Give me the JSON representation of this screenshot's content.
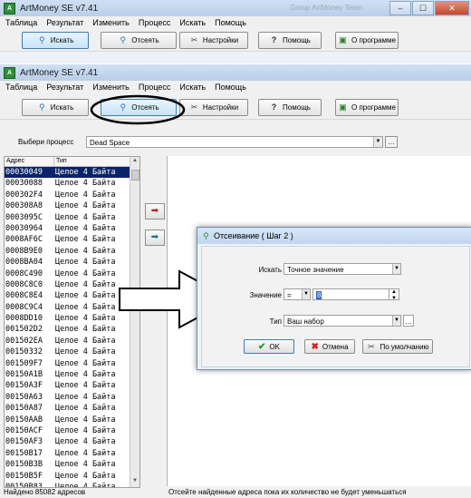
{
  "app": {
    "title": "ArtMoney SE v7.41",
    "icon_text": "A",
    "ghost_title": "Group ArtMoney Team"
  },
  "window_buttons": [
    "–",
    "☐",
    "✕"
  ],
  "menu": [
    "Таблица",
    "Результат",
    "Изменить",
    "Процесс",
    "Искать",
    "Помощь"
  ],
  "toolbar": {
    "search": "Искать",
    "filter": "Отсеять",
    "settings": "Настройки",
    "help": "Помощь",
    "about": "О программе"
  },
  "process": {
    "label": "Выбери процесс",
    "value": "Dead Space"
  },
  "list": {
    "headers": [
      "Адрес",
      "Тип"
    ],
    "rows": [
      [
        "00030049",
        "Целое 4 Байта"
      ],
      [
        "00030088",
        "Целое 4 Байта"
      ],
      [
        "000302F4",
        "Целое 4 Байта"
      ],
      [
        "000308A8",
        "Целое 4 Байта"
      ],
      [
        "0003095C",
        "Целое 4 Байта"
      ],
      [
        "00030964",
        "Целое 4 Байта"
      ],
      [
        "0008AF6C",
        "Целое 4 Байта"
      ],
      [
        "0008B9E0",
        "Целое 4 Байта"
      ],
      [
        "0008BA04",
        "Целое 4 Байта"
      ],
      [
        "0008C490",
        "Целое 4 Байта"
      ],
      [
        "0008C8C0",
        "Целое 4 Байта"
      ],
      [
        "0008C8E4",
        "Целое 4 Байта"
      ],
      [
        "0008C9C4",
        "Целое 4 Байта"
      ],
      [
        "0008DD10",
        "Целое 4 Байта"
      ],
      [
        "001502D2",
        "Целое 4 Байта"
      ],
      [
        "001502EA",
        "Целое 4 Байта"
      ],
      [
        "00150332",
        "Целое 4 Байта"
      ],
      [
        "001509F7",
        "Целое 4 Байта"
      ],
      [
        "00150A1B",
        "Целое 4 Байта"
      ],
      [
        "00150A3F",
        "Целое 4 Байта"
      ],
      [
        "00150A63",
        "Целое 4 Байта"
      ],
      [
        "00150A87",
        "Целое 4 Байта"
      ],
      [
        "00150AAB",
        "Целое 4 Байта"
      ],
      [
        "00150ACF",
        "Целое 4 Байта"
      ],
      [
        "00150AF3",
        "Целое 4 Байта"
      ],
      [
        "00150B17",
        "Целое 4 Байта"
      ],
      [
        "00150B3B",
        "Целое 4 Байта"
      ],
      [
        "00150B5F",
        "Целое 4 Байта"
      ],
      [
        "00150B83",
        "Целое 4 Байта"
      ]
    ]
  },
  "status": {
    "left": "Найдено 85082 адресов",
    "right": "Отсейте найденные адреса пока их количество не будет уменьшаться"
  },
  "dialog": {
    "title": "Отсеивание ( Шаг 2 )",
    "search_label": "Искать",
    "search_value": "Точное значение",
    "value_label": "Значение",
    "value_op": "=",
    "value": "8",
    "type_label": "Тип",
    "type_value": "Ваш набор",
    "ok": "OK",
    "cancel": "Отмена",
    "default": "По умолчанию"
  }
}
